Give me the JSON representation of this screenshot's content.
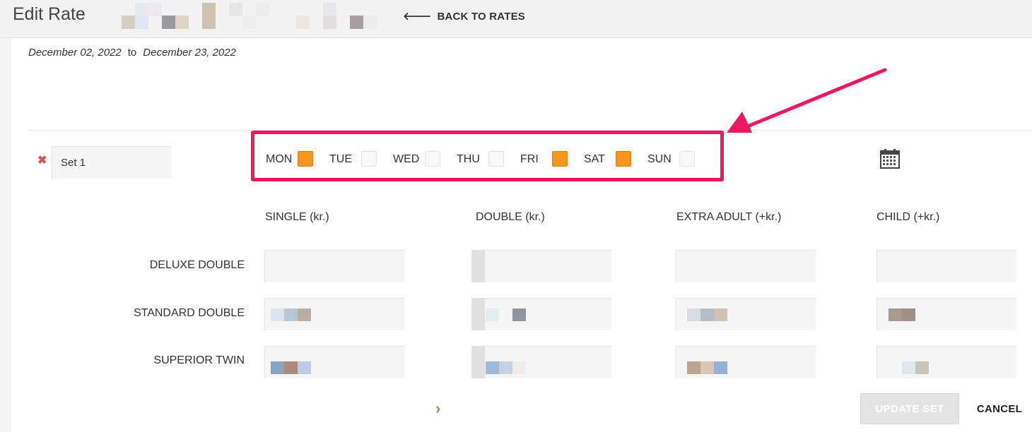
{
  "header": {
    "title": "Edit Rate",
    "back_label": "BACK TO RATES",
    "back_icon": "arrow-left-icon"
  },
  "date_range": {
    "start": "December 02, 2022",
    "separator": "to",
    "end": "December 23, 2022"
  },
  "rate_set": {
    "name": "Set 1",
    "remove_icon": "close-icon",
    "days": [
      {
        "label": "MON",
        "checked": true
      },
      {
        "label": "TUE",
        "checked": false
      },
      {
        "label": "WED",
        "checked": false
      },
      {
        "label": "THU",
        "checked": false
      },
      {
        "label": "FRI",
        "checked": true
      },
      {
        "label": "SAT",
        "checked": true
      },
      {
        "label": "SUN",
        "checked": false
      }
    ],
    "calendar_icon": "calendar-icon"
  },
  "rates_table": {
    "columns": [
      "SINGLE (kr.)",
      "DOUBLE (kr.)",
      "EXTRA ADULT (+kr.)",
      "CHILD (+kr.)"
    ],
    "rows": [
      "DELUXE DOUBLE",
      "STANDARD DOUBLE",
      "SUPERIOR TWIN"
    ]
  },
  "footer": {
    "next_icon": "chevron-right-icon",
    "update_label": "UPDATE SET",
    "cancel_label": "CANCEL"
  },
  "colors": {
    "highlight_border": "#f0175f",
    "checkbox_checked": "#f7941d",
    "remove_icon": "#d9534f",
    "next_arrow": "#6aa84f"
  }
}
